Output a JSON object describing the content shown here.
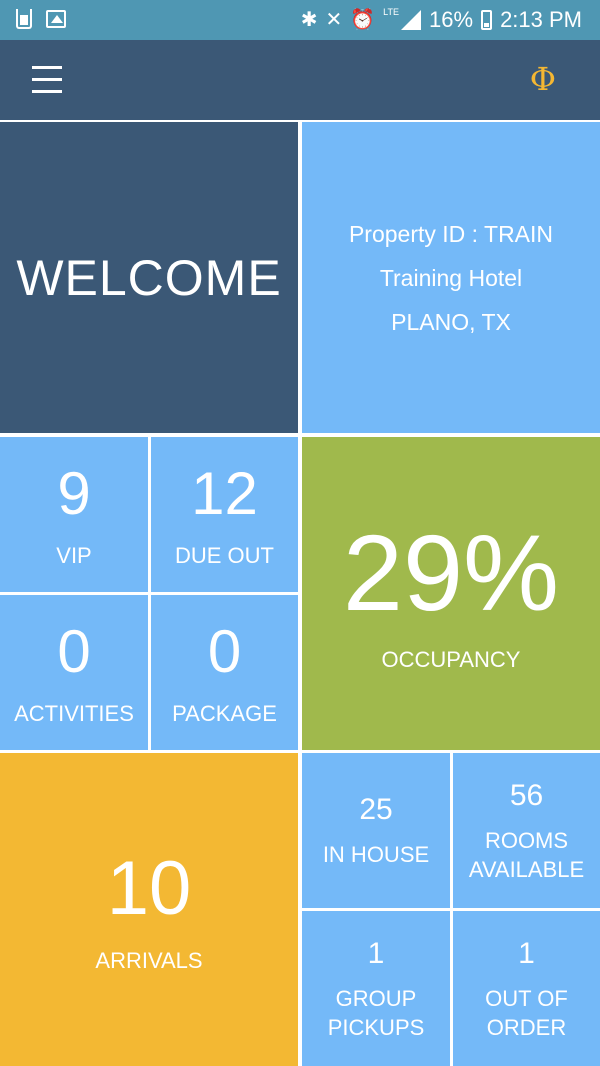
{
  "status_bar": {
    "battery": "16%",
    "time": "2:13 PM",
    "network": "LTE",
    "icons": [
      "cup-icon",
      "image-icon",
      "bluetooth-icon",
      "vibrate-mute-icon",
      "alarm-icon",
      "signal-icon",
      "battery-icon"
    ]
  },
  "app_bar": {
    "menu_icon": "hamburger-menu-icon",
    "logo_glyph": "Φ",
    "logo_color": "#f5b732"
  },
  "colors": {
    "navy": "#3b5876",
    "blue": "#74b9f8",
    "green": "#a0b94c",
    "yellow": "#f3b833",
    "status_bar": "#4f97b3"
  },
  "welcome": {
    "title": "WELCOME"
  },
  "property": {
    "id_line": "Property ID  :  TRAIN",
    "name": "Training Hotel",
    "location": "PLANO, TX"
  },
  "stats": {
    "vip": {
      "value": "9",
      "label": "VIP"
    },
    "due_out": {
      "value": "12",
      "label": "DUE OUT"
    },
    "activities": {
      "value": "0",
      "label": "ACTIVITIES"
    },
    "package": {
      "value": "0",
      "label": "PACKAGE"
    },
    "occupancy": {
      "value": "29%",
      "label": "OCCUPANCY"
    },
    "arrivals": {
      "value": "10",
      "label": "ARRIVALS"
    },
    "in_house": {
      "value": "25",
      "label": "IN HOUSE"
    },
    "rooms_available": {
      "value": "56",
      "label_line1": "ROOMS",
      "label_line2": "AVAILABLE"
    },
    "group_pickups": {
      "value": "1",
      "label_line1": "GROUP",
      "label_line2": "PICKUPS"
    },
    "out_of_order": {
      "value": "1",
      "label_line1": "OUT OF",
      "label_line2": "ORDER"
    }
  }
}
